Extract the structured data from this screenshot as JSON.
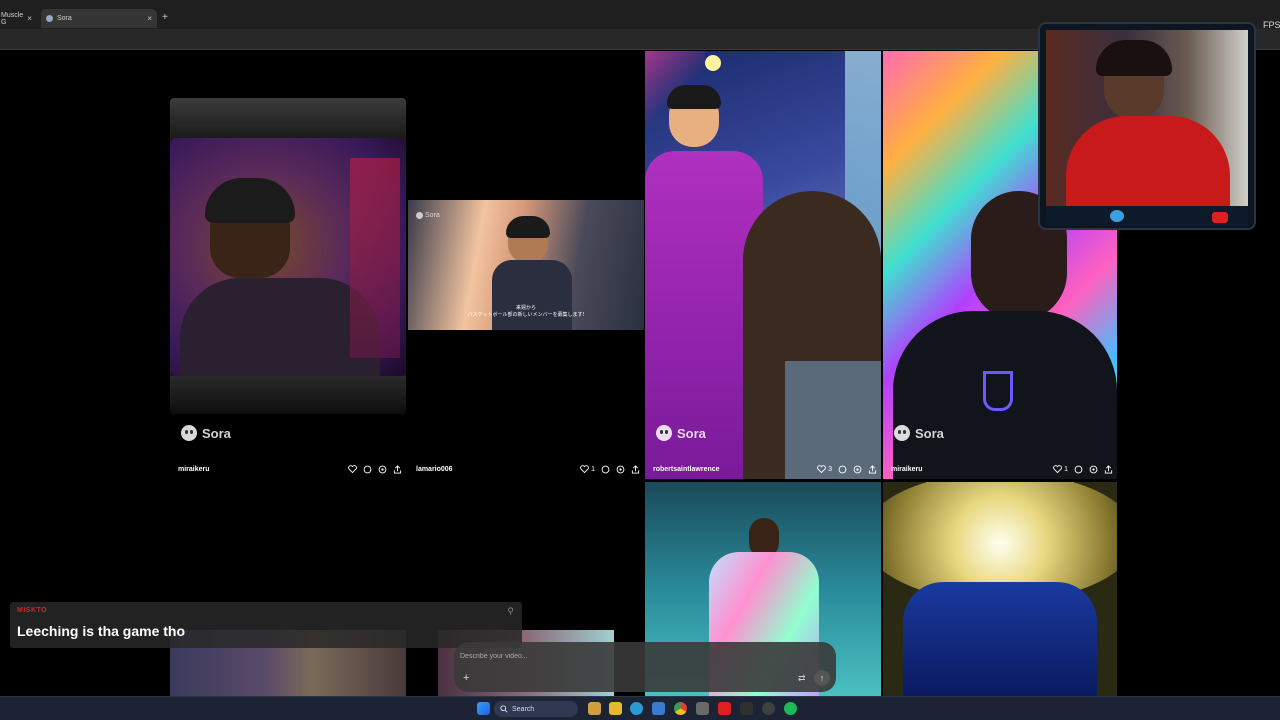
{
  "browser": {
    "tabs": [
      {
        "label": "Muscle G",
        "active": false
      },
      {
        "label": "Sora",
        "active": true
      }
    ],
    "new_tab_label": "+",
    "close_glyph": "×"
  },
  "stream": {
    "fps_label": "FPS"
  },
  "feed": {
    "sora_label": "Sora",
    "tiles": [
      {
        "user": "miraikeru",
        "likes": "",
        "comments": ""
      },
      {
        "user": "lamario006",
        "likes": "1",
        "comments": ""
      },
      {
        "user": "robertsaintlawrence",
        "likes": "3",
        "comments": ""
      },
      {
        "user": "miraikeru",
        "likes": "1",
        "comments": ""
      }
    ],
    "subtitle_jp_1": "来週から",
    "subtitle_jp_2": "バスケットボール部の新しいメンバーを募集します!"
  },
  "chat": {
    "username": "MISKTO",
    "message": "Leeching is tha game tho",
    "close_glyph": "⚲"
  },
  "composer": {
    "placeholder": "Describe your video...",
    "add_glyph": "+",
    "settings_glyph": "⇄",
    "send_glyph": "↑"
  },
  "taskbar": {
    "search_label": "Search"
  },
  "colors": {
    "background": "#000000",
    "chat_name": "#e02020",
    "taskbar": "#1c2335"
  }
}
